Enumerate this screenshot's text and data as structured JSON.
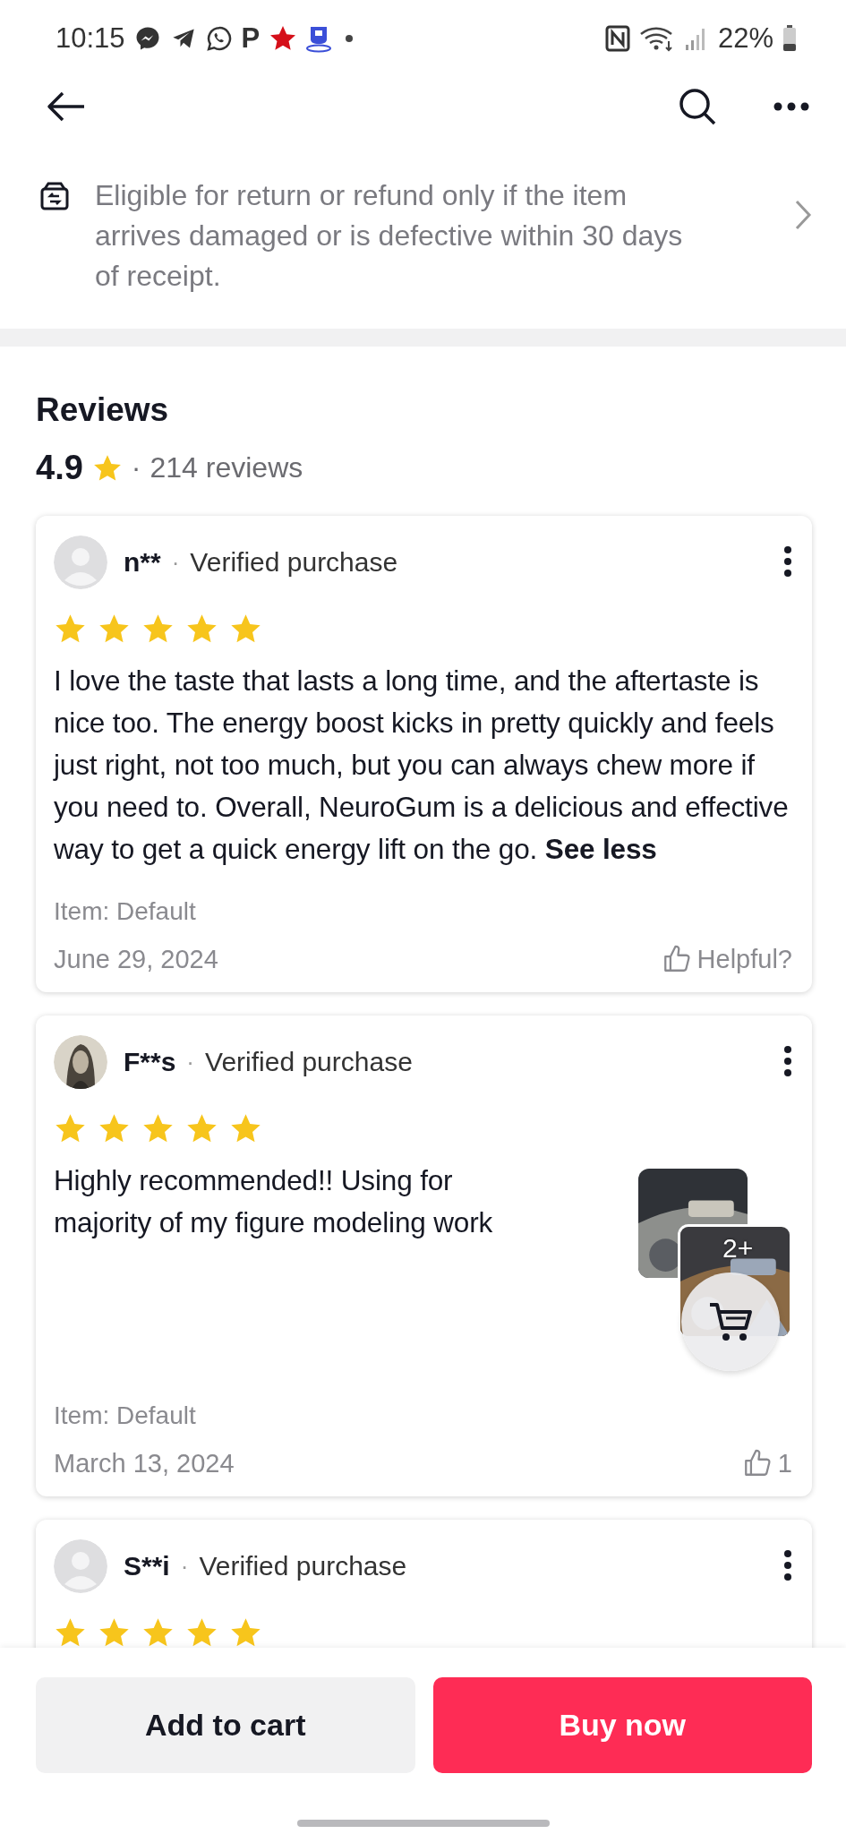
{
  "status_bar": {
    "time": "10:15",
    "notification_letter": "P",
    "battery": "22%"
  },
  "return_policy": {
    "text": "Eligible for return or refund only if the item arrives damaged or is defective within 30 days of receipt."
  },
  "reviews": {
    "title": "Reviews",
    "rating": "4.9",
    "separator": "·",
    "count": "214 reviews",
    "items": [
      {
        "avatar": {
          "kind": "placeholder"
        },
        "user": "n**",
        "separator": "·",
        "badge": "Verified purchase",
        "stars": 5,
        "body": "I love the taste that lasts a long time, and the aftertaste is nice too. The energy boost kicks in pretty quickly and feels just right, not too much, but you can always chew more if you need to. Overall, NeuroGum is a delicious and effective way to get a quick energy lift on the go.",
        "toggle": "See less",
        "item": "Item: Default",
        "date": "June 29, 2024",
        "helpful": "Helpful?"
      },
      {
        "avatar": {
          "kind": "picture"
        },
        "user": "F**s",
        "separator": "·",
        "badge": "Verified purchase",
        "stars": 5,
        "body": "Highly recommended!! Using for majority of my figure modeling work",
        "item": "Item: Default",
        "date": "March 13, 2024",
        "helpful": "1",
        "photos": [
          {
            "kind": "picture"
          },
          {
            "kind": "picture"
          }
        ],
        "more_photos": "2+"
      },
      {
        "avatar": {
          "kind": "placeholder"
        },
        "user": "S**i",
        "separator": "·",
        "badge": "Verified purchase",
        "stars": 5
      }
    ]
  },
  "actions": {
    "add_to_cart": "Add to cart",
    "buy_now": "Buy now"
  }
}
